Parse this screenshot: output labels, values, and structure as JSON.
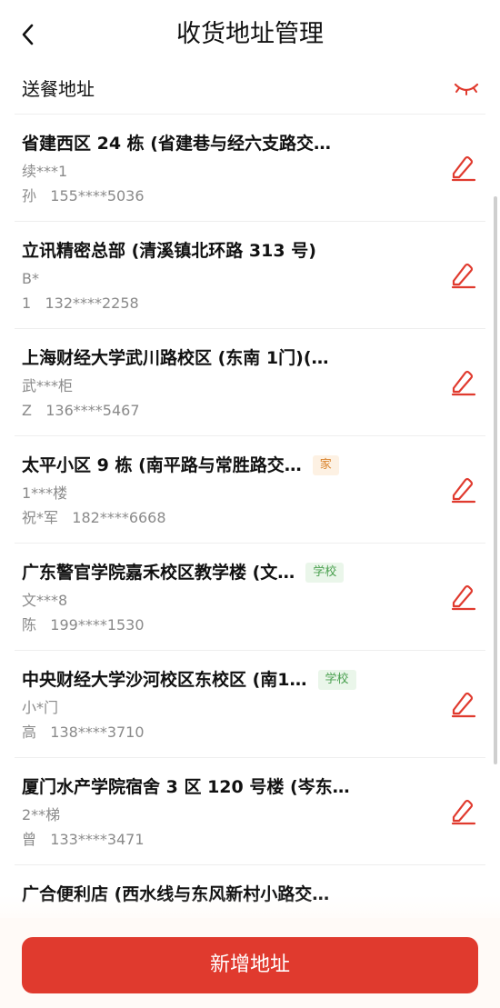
{
  "header": {
    "title": "收货地址管理"
  },
  "section": {
    "label": "送餐地址"
  },
  "colors": {
    "accent": "#e03a2e",
    "home_tag": "#d9822b",
    "school_tag": "#4aa04f"
  },
  "addresses": [
    {
      "title": "省建西区 24 栋 (省建巷与经六支路交…",
      "tag": "",
      "detail": "续***1",
      "name": "孙",
      "phone": "155****5036"
    },
    {
      "title": "立讯精密总部 (清溪镇北环路 313 号)",
      "tag": "",
      "detail": "B*",
      "name": "1",
      "phone": "132****2258"
    },
    {
      "title": "上海财经大学武川路校区 (东南 1门)(…",
      "tag": "",
      "detail": "武***柜",
      "name": "Z",
      "phone": "136****5467"
    },
    {
      "title": "太平小区 9 栋 (南平路与常胜路交…",
      "tag": "家",
      "detail": "1***楼",
      "name": "祝*军",
      "phone": "182****6668"
    },
    {
      "title": "广东警官学院嘉禾校区教学楼 (文…",
      "tag": "学校",
      "detail": "文***8",
      "name": "陈",
      "phone": "199****1530"
    },
    {
      "title": "中央财经大学沙河校区东校区 (南1…",
      "tag": "学校",
      "detail": "小*门",
      "name": "高",
      "phone": "138****3710"
    },
    {
      "title": "厦门水产学院宿舍 3 区 120 号楼 (岑东…",
      "tag": "",
      "detail": "2**梯",
      "name": "曾",
      "phone": "133****3471"
    },
    {
      "title": "广合便利店 (西水线与东风新村小路交…",
      "tag": "",
      "detail": "",
      "name": "",
      "phone": ""
    }
  ],
  "footer": {
    "add_label": "新增地址"
  }
}
